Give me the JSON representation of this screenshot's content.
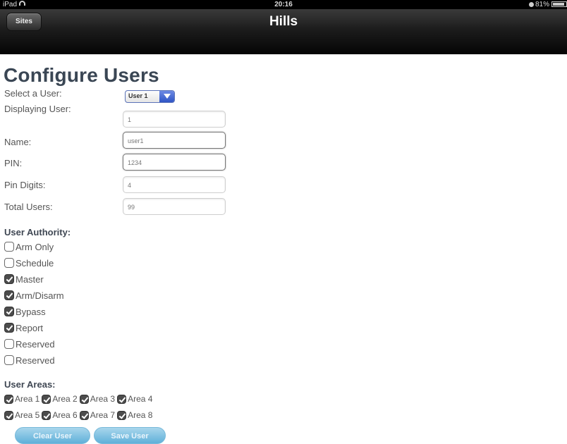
{
  "status_bar": {
    "carrier": "iPad",
    "time": "20:16",
    "battery": "81%"
  },
  "nav": {
    "back_label": "Sites",
    "title": "Hills"
  },
  "page_title": "Configure Users",
  "form": {
    "select_user_label": "Select a User:",
    "select_user_value": "User 1",
    "displaying_user_label": "Displaying User:",
    "displaying_user_value": "1",
    "name_label": "Name:",
    "name_value": "user1",
    "pin_label": "PIN:",
    "pin_value": "1234",
    "pin_digits_label": "Pin Digits:",
    "pin_digits_value": "4",
    "total_users_label": "Total Users:",
    "total_users_value": "99"
  },
  "authority": {
    "heading": "User Authority:",
    "items": [
      {
        "label": "Arm Only",
        "checked": false
      },
      {
        "label": "Schedule",
        "checked": false
      },
      {
        "label": "Master",
        "checked": true
      },
      {
        "label": "Arm/Disarm",
        "checked": true
      },
      {
        "label": "Bypass",
        "checked": true
      },
      {
        "label": "Report",
        "checked": true
      },
      {
        "label": "Reserved",
        "checked": false
      },
      {
        "label": "Reserved",
        "checked": false
      }
    ]
  },
  "areas": {
    "heading": "User Areas:",
    "items": [
      {
        "label": "Area 1",
        "checked": true
      },
      {
        "label": "Area 2",
        "checked": true
      },
      {
        "label": "Area 3",
        "checked": true
      },
      {
        "label": "Area 4",
        "checked": true
      },
      {
        "label": "Area 5",
        "checked": true
      },
      {
        "label": "Area 6",
        "checked": true
      },
      {
        "label": "Area 7",
        "checked": true
      },
      {
        "label": "Area 8",
        "checked": true
      }
    ]
  },
  "buttons": {
    "clear": "Clear User",
    "save": "Save User"
  }
}
